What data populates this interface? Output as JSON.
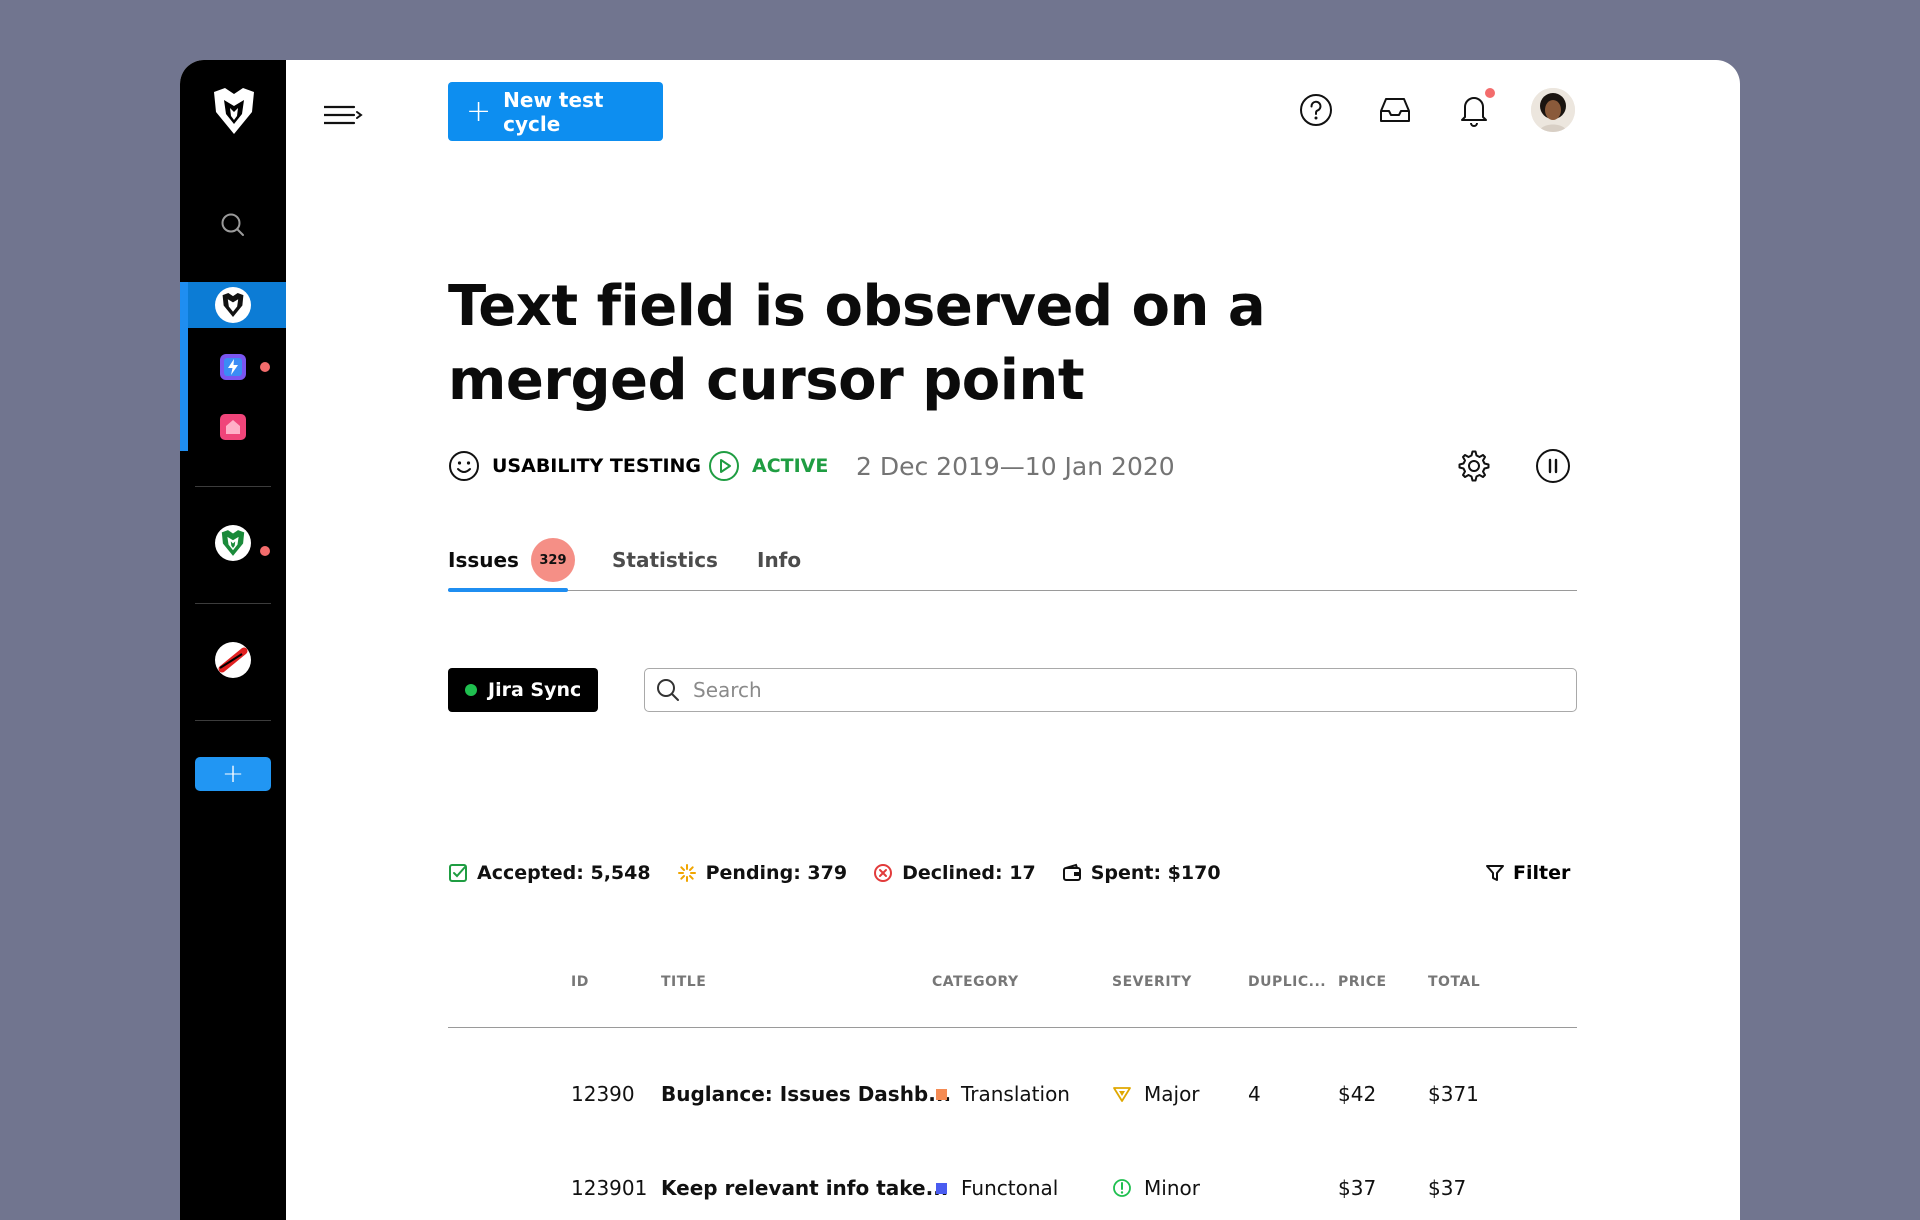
{
  "header": {
    "new_cycle_label": "New test cycle",
    "icons": [
      "menu-toggle-icon",
      "help-icon",
      "inbox-icon",
      "bell-icon",
      "avatar"
    ]
  },
  "sidebar": {
    "icons": [
      "app-logo-icon",
      "search-icon",
      "workspace-icon",
      "lightning-app-icon",
      "home-app-icon",
      "workspace-green-icon",
      "ban-icon",
      "add-icon"
    ],
    "add_label": "+"
  },
  "cycle": {
    "title": "Text field is observed on a merged cursor point",
    "type": "USABILITY TESTING",
    "status": "ACTIVE",
    "status_color": "#1f9d42",
    "date_range": "2 Dec 2019—10 Jan 2020"
  },
  "tabs": [
    {
      "label": "Issues",
      "badge": "329"
    },
    {
      "label": "Statistics"
    },
    {
      "label": "Info"
    }
  ],
  "toolbar": {
    "jira_label": "Jira Sync",
    "search_placeholder": "Search",
    "filter_label": "Filter"
  },
  "stats": {
    "accepted": "Accepted: 5,548",
    "pending": "Pending: 379",
    "declined": "Declined: 17",
    "spent": "Spent: $170"
  },
  "table": {
    "columns": [
      "ID",
      "TITLE",
      "CATEGORY",
      "SEVERITY",
      "DUPLIC...",
      "PRICE",
      "TOTAL"
    ],
    "rows": [
      {
        "id": "12390",
        "title": "Buglance: Issues Dashb...",
        "category": "Translation",
        "category_color": "#f58b53",
        "severity": "Major",
        "duplicates": "4",
        "price": "$42",
        "total": "$371"
      },
      {
        "id": "123901",
        "title": "Keep relevant info take...",
        "category": "Functonal",
        "category_color": "#4a5cf0",
        "severity": "Minor",
        "duplicates": "",
        "price": "$37",
        "total": "$37"
      }
    ]
  },
  "colors": {
    "accent": "#0d8ef0",
    "badge": "#f58f86",
    "notification": "#f36c6c",
    "major": "#e0a800",
    "minor": "#1fbf4f",
    "declined": "#e23b3b",
    "pending": "#f0a500"
  }
}
